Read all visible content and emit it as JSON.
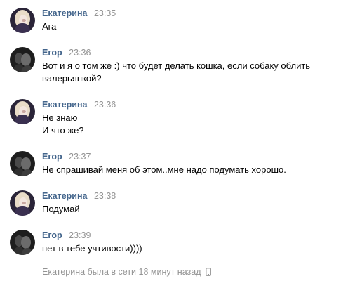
{
  "messages": [
    {
      "author": "Екатерина",
      "time": "23:35",
      "lines": [
        "Ага"
      ],
      "avatar": "avatar-ekaterina"
    },
    {
      "author": "Егор",
      "time": "23:36",
      "lines": [
        "Вот и я о том же :) что будет делать кошка, если собаку облить",
        "валерьянкой?"
      ],
      "avatar": "avatar-egor"
    },
    {
      "author": "Екатерина",
      "time": "23:36",
      "lines": [
        "Не знаю",
        "И что же?"
      ],
      "avatar": "avatar-ekaterina"
    },
    {
      "author": "Егор",
      "time": "23:37",
      "lines": [
        "Не спрашивай меня об этом..мне надо подумать хорошо."
      ],
      "avatar": "avatar-egor"
    },
    {
      "author": "Екатерина",
      "time": "23:38",
      "lines": [
        "Подумай"
      ],
      "avatar": "avatar-ekaterina"
    },
    {
      "author": "Егор",
      "time": "23:39",
      "lines": [
        "нет в тебе учтивости))))"
      ],
      "avatar": "avatar-egor"
    }
  ],
  "status": {
    "text": "Екатерина была в сети 18 минут назад",
    "icon": "mobile-phone-icon"
  },
  "colors": {
    "author": "#42648b",
    "muted": "#939393",
    "text": "#000000",
    "background": "#ffffff"
  }
}
